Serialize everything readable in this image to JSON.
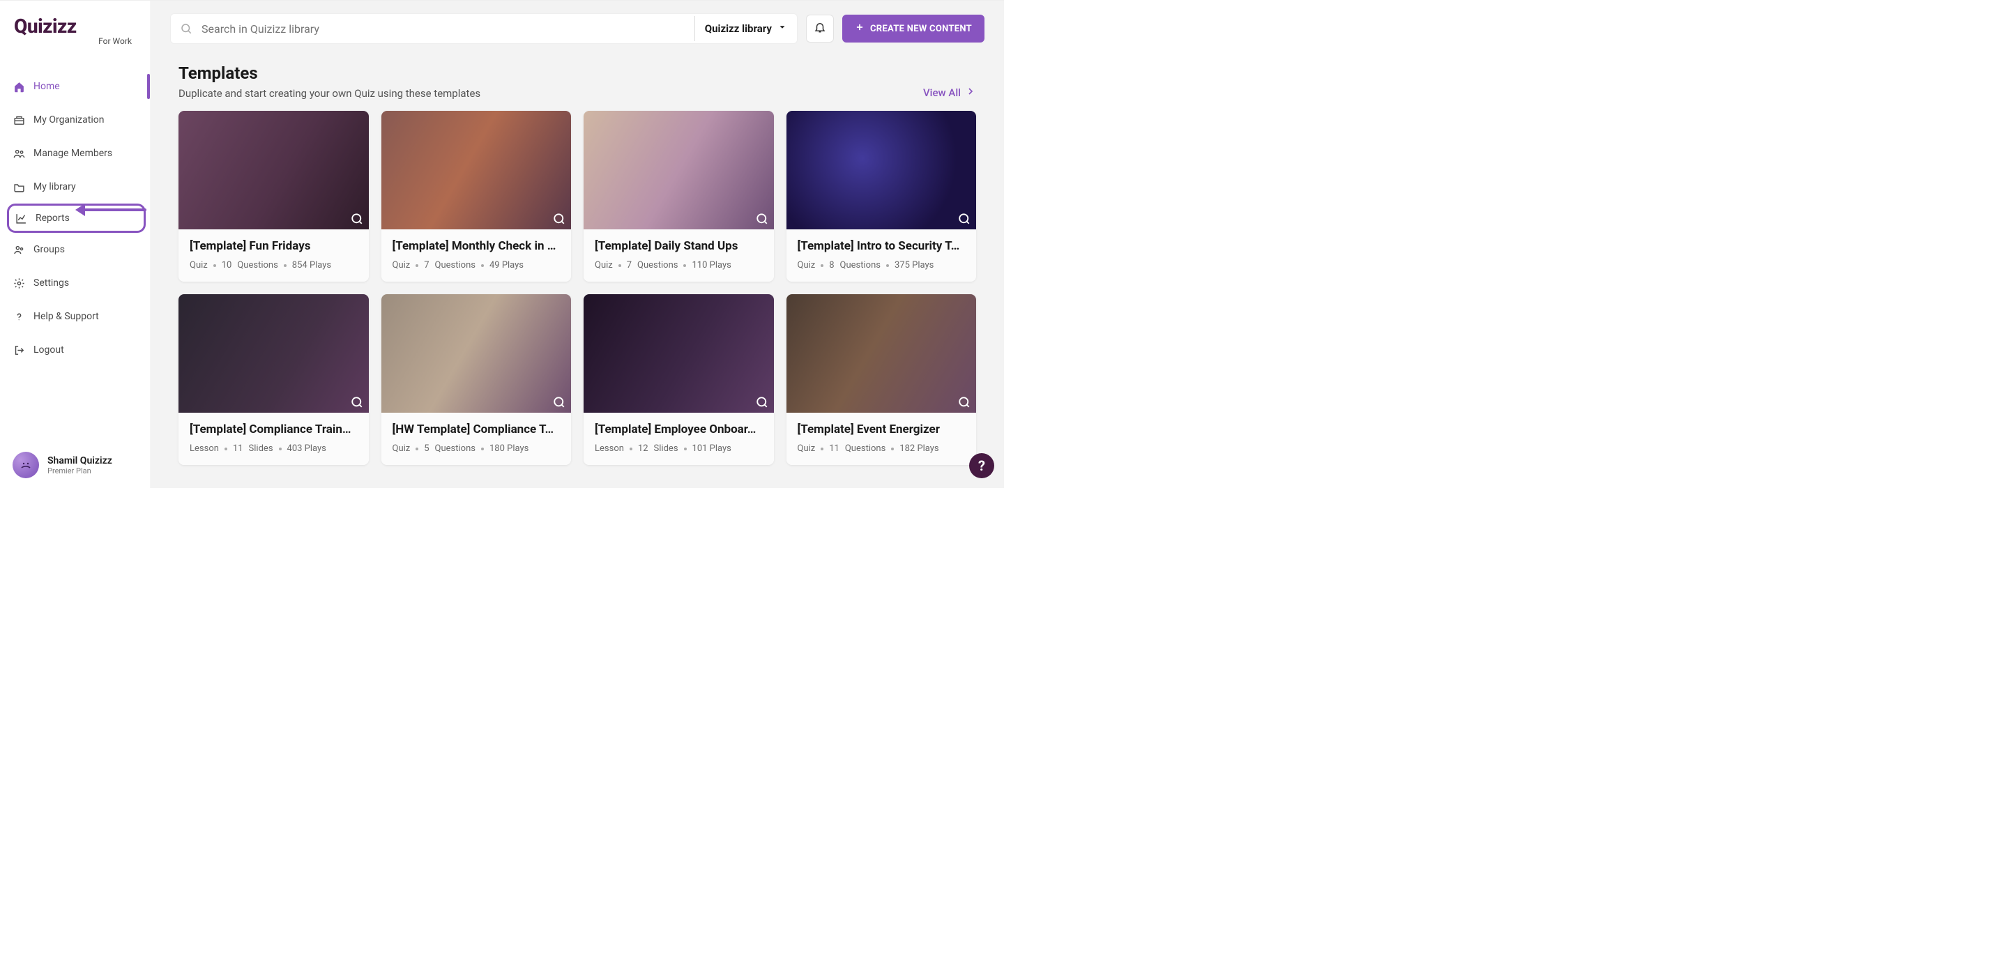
{
  "brand": {
    "name": "Quizizz",
    "sub": "For Work"
  },
  "sidebar": {
    "items": [
      {
        "label": "Home"
      },
      {
        "label": "My Organization"
      },
      {
        "label": "Manage Members"
      },
      {
        "label": "My library"
      },
      {
        "label": "Reports"
      },
      {
        "label": "Groups"
      },
      {
        "label": "Settings"
      },
      {
        "label": "Help & Support"
      },
      {
        "label": "Logout"
      }
    ]
  },
  "user": {
    "name": "Shamil Quizizz",
    "plan": "Premier Plan"
  },
  "search": {
    "placeholder": "Search in Quizizz library"
  },
  "scope": {
    "label": "Quizizz library"
  },
  "create_btn": "CREATE NEW CONTENT",
  "section": {
    "title": "Templates",
    "subtitle": "Duplicate and start creating your own Quiz using these templates",
    "viewall": "View All"
  },
  "cards": [
    {
      "title": "[Template] Fun Fridays",
      "type_label": "Quiz",
      "cn": "10",
      "cu": "Questions",
      "plays": "854 Plays"
    },
    {
      "title": "[Template] Monthly Check in …",
      "type_label": "Quiz",
      "cn": "7",
      "cu": "Questions",
      "plays": "49 Plays"
    },
    {
      "title": "[Template] Daily Stand Ups",
      "type_label": "Quiz",
      "cn": "7",
      "cu": "Questions",
      "plays": "110 Plays"
    },
    {
      "title": "[Template] Intro to Security T…",
      "type_label": "Quiz",
      "cn": "8",
      "cu": "Questions",
      "plays": "375 Plays"
    },
    {
      "title": "[Template] Compliance Train…",
      "type_label": "Lesson",
      "cn": "11",
      "cu": "Slides",
      "plays": "403 Plays"
    },
    {
      "title": "[HW Template] Compliance T…",
      "type_label": "Quiz",
      "cn": "5",
      "cu": "Questions",
      "plays": "180 Plays"
    },
    {
      "title": "[Template] Employee Onboar…",
      "type_label": "Lesson",
      "cn": "12",
      "cu": "Slides",
      "plays": "101 Plays"
    },
    {
      "title": "[Template] Event Energizer",
      "type_label": "Quiz",
      "cn": "11",
      "cu": "Questions",
      "plays": "182 Plays"
    }
  ],
  "help": "?"
}
